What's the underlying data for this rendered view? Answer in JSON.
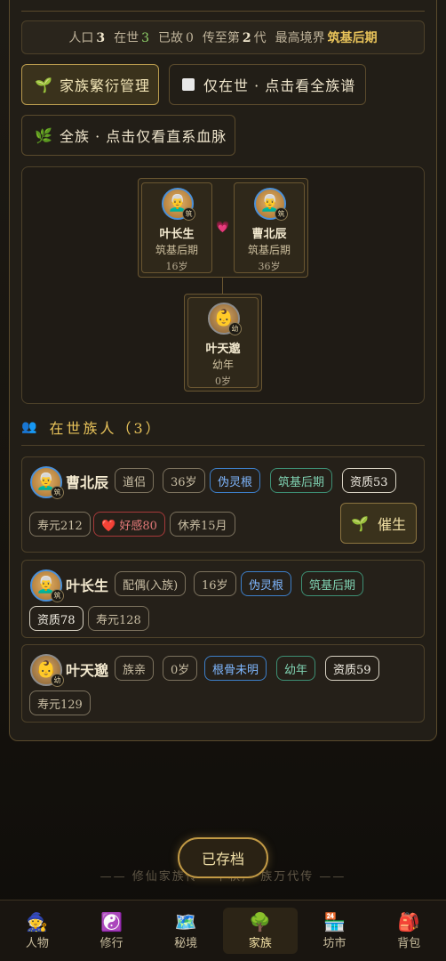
{
  "stats": {
    "population_label": "人口",
    "population": "3",
    "alive_label": "在世",
    "alive": "3",
    "dead_label": "已故",
    "dead": "0",
    "generation_prefix": "传至第",
    "generation": "2",
    "generation_suffix": "代",
    "highest_realm_label": "最高境界",
    "highest_realm": "筑基后期"
  },
  "buttons": {
    "family_manage": "家族繁衍管理",
    "alive_only": "仅在世 · 点击看全族谱",
    "all_clan": "全族 · 点击仅看直系血脉"
  },
  "tree": {
    "couple": [
      {
        "name": "叶长生",
        "realm": "筑基后期",
        "age": "16岁",
        "badge": "筑"
      },
      {
        "name": "曹北辰",
        "realm": "筑基后期",
        "age": "36岁",
        "badge": "筑"
      }
    ],
    "child": {
      "name": "叶天邈",
      "realm": "幼年",
      "age": "0岁",
      "badge": "幼"
    }
  },
  "section": {
    "title": "在世族人",
    "count": "（3）"
  },
  "members": [
    {
      "name": "曹北辰",
      "badge": "筑",
      "tags_row1": [
        "道侣",
        "36岁",
        "伪灵根",
        "筑基后期",
        "资质53"
      ],
      "tags_row2": [
        "寿元212",
        "❤️ 好感80",
        "休养15月"
      ],
      "action": "催生"
    },
    {
      "name": "叶长生",
      "badge": "筑",
      "tags_row1": [
        "配偶(入族)",
        "16岁",
        "伪灵根",
        "筑基后期"
      ],
      "tags_row2": [
        "资质78",
        "寿元128"
      ]
    },
    {
      "name": "叶天邈",
      "badge": "幼",
      "tags_row1": [
        "族亲",
        "0岁",
        "根骨未明",
        "幼年",
        "资质59"
      ],
      "tags_row2": [
        "寿元129"
      ]
    }
  ],
  "footer": {
    "motto": "—— 修仙家族传 · 千秋,一族万代传 ——",
    "saved": "已存档"
  },
  "nav": [
    {
      "label": "人物",
      "icon": "🧙"
    },
    {
      "label": "修行",
      "icon": "☯️"
    },
    {
      "label": "秘境",
      "icon": "🗺️"
    },
    {
      "label": "家族",
      "icon": "🌳"
    },
    {
      "label": "坊市",
      "icon": "🏪"
    },
    {
      "label": "背包",
      "icon": "🎒"
    }
  ]
}
